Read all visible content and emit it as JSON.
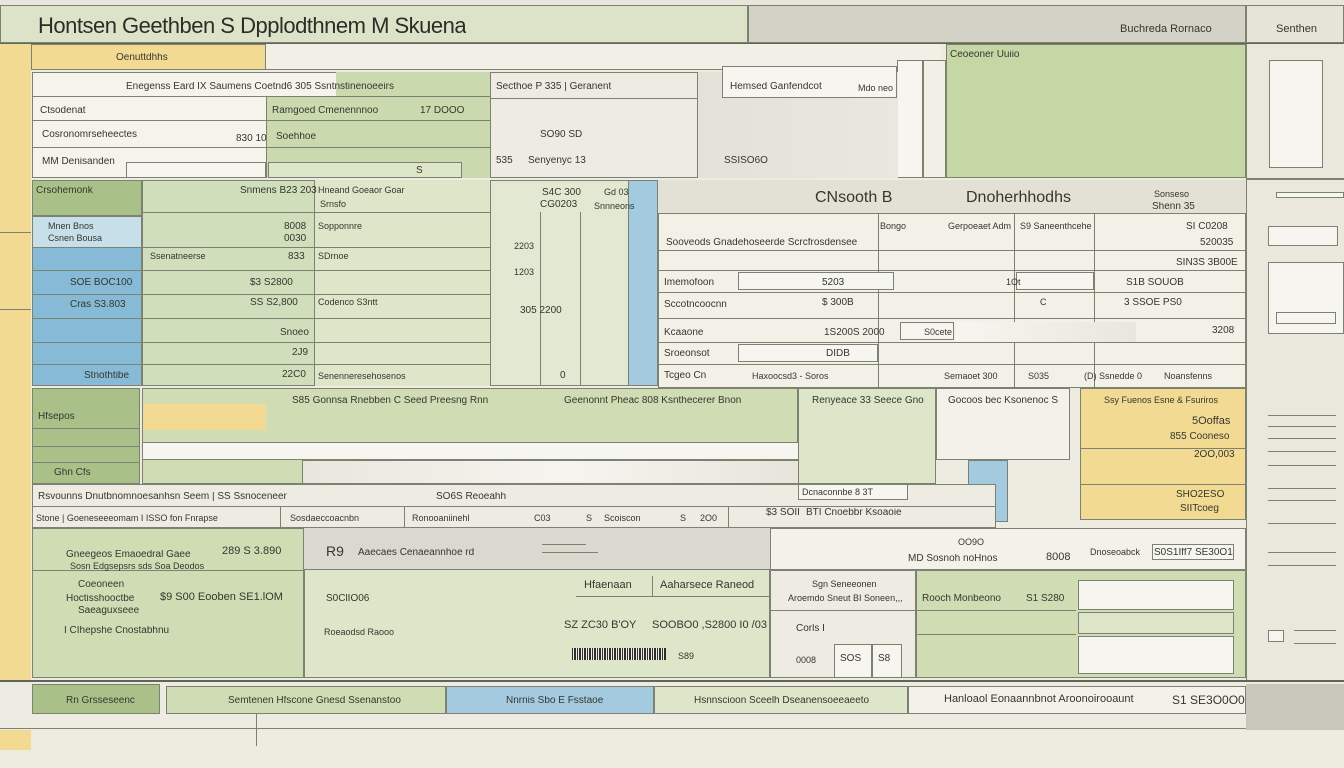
{
  "window": {
    "title": "Hontsen Geethben S Dpplodthnem M Skuena",
    "header_right": [
      "Buchreda Rornaco",
      "Senthen"
    ]
  },
  "top_strip": {
    "tab": "Oenuttdhhs",
    "right_top": "Ceoeoner Uuiio"
  },
  "left_form": {
    "header": "Enegenss Eard IX Saumens Coetnd6 305 Ssntnstinenoeeirs",
    "row1_left": "Ctsodenat",
    "row1_mid": "Ramgoed Cmenennnoo",
    "row1_right": "17 DOOO",
    "row2_left": "Cosronomrseheectes",
    "row2_val": "830 10",
    "row2_mid": "Soehhoe",
    "row3_left": "MM Denisanden",
    "row3_val": "S"
  },
  "center_top": {
    "header": "Secthoe P 335 | Geranent",
    "val1": "SO90 SD",
    "val2_a": "535",
    "val2_b": "Senyenyc 13"
  },
  "mid_top": {
    "label": "Hemsed Ganfendcot",
    "hint": "Mdo neo",
    "val": "SSISO6O"
  },
  "grid_left": {
    "col_header": "Crsohemonk",
    "label_blue": [
      "Mnen Bnos",
      "Csnen Bousa"
    ],
    "rows": [
      "SOE BOC100",
      "Cras S3.803",
      "",
      "Stnothtibe"
    ]
  },
  "grid_mid": {
    "header_a": "Snmens B23 203",
    "header_b": "Hneand Goeaor Goar",
    "header_c": "Srnsfo",
    "vals": [
      "8008",
      "0030",
      "833",
      "$3 S2800",
      "SS S2,800",
      "Snoeo",
      "2J9",
      "22C0"
    ],
    "labels": [
      "Sopponnre",
      "Ssenatneerse",
      "SDrnoe",
      "Codenco S3ntt",
      "Senenneresehosenos"
    ]
  },
  "grid_center": {
    "head": "S4C 300",
    "head2": "CG0203",
    "head3": "Gd 03",
    "head4": "Snnneons",
    "v": [
      "2203",
      "1203",
      "305  2200",
      "0"
    ]
  },
  "right_block": {
    "title_a": "CNsooth B",
    "title_b": "Dnoherhhodhs",
    "title_c": "Sonseso",
    "title_d": "Shenn 35",
    "sub": "Sooveods Gnadehoseerde Scrcfrosdensee",
    "col_a": "Bongo",
    "col_b": "Gerpoeaet Adm",
    "col_c": "S9 Saneenthcehe",
    "vals_r": [
      "SI C0208",
      "520035",
      "SIN3S 3B00E",
      "S1B SOUOB",
      "3 SSOE PS0",
      "3208"
    ],
    "row_labels": [
      "Imemofoon",
      "Sccotncoocnn",
      "Kcaaone",
      "Sroeonsot"
    ],
    "row_vals": [
      "5203",
      "$ 300B",
      "1S200S 2000",
      "DIDB"
    ],
    "mini": [
      "1Ot",
      "C",
      "S0cete"
    ],
    "bottom_row": [
      "Tcgeo Cn",
      "Haxoocsd3 - Soros",
      "Semaoet 300",
      "S035",
      "(D) Ssnedde 0",
      "Noansfenns"
    ]
  },
  "middle_band": {
    "left": "Hfsepos",
    "center": "S85 Gonnsa Rnebben C Seed Preesng Rnn",
    "center2": "Geenonnt Pheac 808 Ksnthecerer Bnon",
    "col3": "Renyeace 33 Seece Gno",
    "col4": "Gocoos bec Ksonenoc S",
    "col5": "Ssy Fuenos Esne & Fsuriros",
    "col5_vals": [
      "5Ooffas",
      "855 Cooneso",
      "2OO,003"
    ],
    "sub_left": "Ghn Cfs"
  },
  "lower_strip": {
    "label": "Rsvounns Dnutbnomnoesanhsn Seem | SS Ssnoceneer",
    "label2": "SO6S Reoeahh",
    "label3": "Dcnaconnbe 8 3T",
    "label4": "SIITcoeg",
    "label5": "SHO2ESO",
    "row2": [
      "Stone | Goeneseeeomam I ISSO fon Fnrapse",
      "Sosdaeccoacnbn",
      "Ronooaniinehl",
      "C03",
      "S",
      "Scoiscon",
      "S",
      "2O0",
      "$3 SOII",
      "BTI  Cnoebbr Ksoaoie"
    ]
  },
  "bottom_form": {
    "a_line1": "Gneegeos Emaoedral Gaee",
    "a_line1_v": "289  S 3.890",
    "a_line2": "Sosn Edgsepsrs sds Soa Deodos",
    "a_line3": "Coeoneen",
    "a_line4": "Hoctisshooctbe",
    "a_line4_v": "$9 S00  Eooben SE1.lOM",
    "a_line5": "Saeaguxseee",
    "a_line6": "I  CIhepshe Cnostabhnu",
    "b_big": "R9",
    "b_sub": "Aaecaes Cenaeannhoe rd",
    "b_left": "S0ClIO06",
    "b_left2": "Roeaodsd Raooo",
    "c_head": "Hfaenaan",
    "c_head2": "Aaharsece Raneod",
    "c_v1": "SZ ZC30 B'OY",
    "c_v2": "SOOBO0 ,S2800 I0 /03",
    "c_v3": "S89",
    "d_head": "Sgn Seneeonen",
    "d_sub": "Aroemdo Sneut BI Soneen,,,",
    "d_v1": "Corls I",
    "d_v2": "0008",
    "d_v3": "SOS",
    "d_v4": "S8",
    "e_head": "OO9O",
    "e_sub": "MD  Sosnoh noHnos",
    "e_v": "8008",
    "e_lbl": "Dnoseoabck",
    "e_r": "S0S1Iff7 SE30O1",
    "f_label": "Rooch Monbeono",
    "f_val": "S1 S280"
  },
  "footer_bar": {
    "a": "Rn Grsseseenc",
    "b": "Semtenen Hfscone Gnesd Ssenanstoo",
    "c": "Nnrnis Sbo E Fsstaoe",
    "d": "Hsnnscioon Sceelh Dseanensoeeaeeto",
    "e": "Hanloaol Eonaannbnot Aroonoirooaunt",
    "f": "S1 SE3O0O0"
  },
  "colors": {
    "background": "#eeebe0",
    "green": "#cfdcb4",
    "green_light": "#dde6c8",
    "green_dark": "#a9c188",
    "blue": "#86bad6",
    "yellow": "#f3da92",
    "paper": "#f7f5ef",
    "line": "#7c8271",
    "header_gray": "#dcd8cd"
  }
}
